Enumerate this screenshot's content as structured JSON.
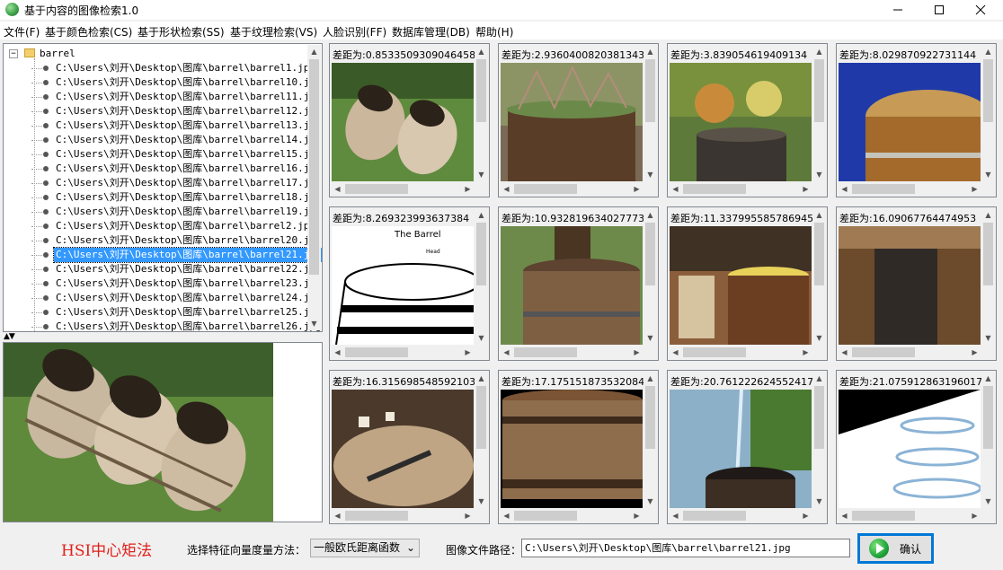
{
  "window": {
    "title": "基于内容的图像检索1.0"
  },
  "menu": [
    "文件(F)",
    "基于颜色检索(CS)",
    "基于形状检索(SS)",
    "基于纹理检索(VS)",
    "人脸识别(FF)",
    "数据库管理(DB)",
    "帮助(H)"
  ],
  "tree": {
    "root": "barrel",
    "items": [
      "C:\\Users\\刘开\\Desktop\\图库\\barrel\\barrel1.jpg",
      "C:\\Users\\刘开\\Desktop\\图库\\barrel\\barrel10.jpg",
      "C:\\Users\\刘开\\Desktop\\图库\\barrel\\barrel11.jpg",
      "C:\\Users\\刘开\\Desktop\\图库\\barrel\\barrel12.jpg",
      "C:\\Users\\刘开\\Desktop\\图库\\barrel\\barrel13.jpg",
      "C:\\Users\\刘开\\Desktop\\图库\\barrel\\barrel14.jpg",
      "C:\\Users\\刘开\\Desktop\\图库\\barrel\\barrel15.jpg",
      "C:\\Users\\刘开\\Desktop\\图库\\barrel\\barrel16.jpg",
      "C:\\Users\\刘开\\Desktop\\图库\\barrel\\barrel17.jpg",
      "C:\\Users\\刘开\\Desktop\\图库\\barrel\\barrel18.jpg",
      "C:\\Users\\刘开\\Desktop\\图库\\barrel\\barrel19.jpg",
      "C:\\Users\\刘开\\Desktop\\图库\\barrel\\barrel2.jpg",
      "C:\\Users\\刘开\\Desktop\\图库\\barrel\\barrel20.jpg",
      "C:\\Users\\刘开\\Desktop\\图库\\barrel\\barrel21.jpg",
      "C:\\Users\\刘开\\Desktop\\图库\\barrel\\barrel22.jpg",
      "C:\\Users\\刘开\\Desktop\\图库\\barrel\\barrel23.jpg",
      "C:\\Users\\刘开\\Desktop\\图库\\barrel\\barrel24.jpg",
      "C:\\Users\\刘开\\Desktop\\图库\\barrel\\barrel25.jpg",
      "C:\\Users\\刘开\\Desktop\\图库\\barrel\\barrel26.jpg"
    ],
    "selected_index": 13
  },
  "results": [
    {
      "distance": "差距为:0.8533509309046458"
    },
    {
      "distance": "差距为:2.9360400820381343"
    },
    {
      "distance": "差距为:3.839054619409134"
    },
    {
      "distance": "差距为:8.029870922731144"
    },
    {
      "distance": "差距为:8.269323993637384",
      "image_text": [
        "The Barrel",
        "Head"
      ]
    },
    {
      "distance": "差距为:10.932819634027773"
    },
    {
      "distance": "差距为:11.337995585786945"
    },
    {
      "distance": "差距为:16.09067764474953"
    },
    {
      "distance": "差距为:16.315698548592103"
    },
    {
      "distance": "差距为:17.175151873532084"
    },
    {
      "distance": "差距为:20.761222624552417"
    },
    {
      "distance": "差距为:21.075912863196017"
    }
  ],
  "bottom": {
    "method_title": "HSI中心矩法",
    "select_label": "选择特征向量度量方法：",
    "select_value": "一般欧氏距离函数",
    "path_label": "图像文件路径：",
    "path_value": "C:\\Users\\刘开\\Desktop\\图库\\barrel\\barrel21.jpg",
    "confirm_label": "确认"
  },
  "colors": {
    "selection": "#3399ff",
    "method_title": "#e0201a",
    "focus": "#0078d7"
  },
  "icons": [
    "app-icon",
    "minimize-icon",
    "maximize-icon",
    "close-icon",
    "folder-icon",
    "play-icon"
  ]
}
